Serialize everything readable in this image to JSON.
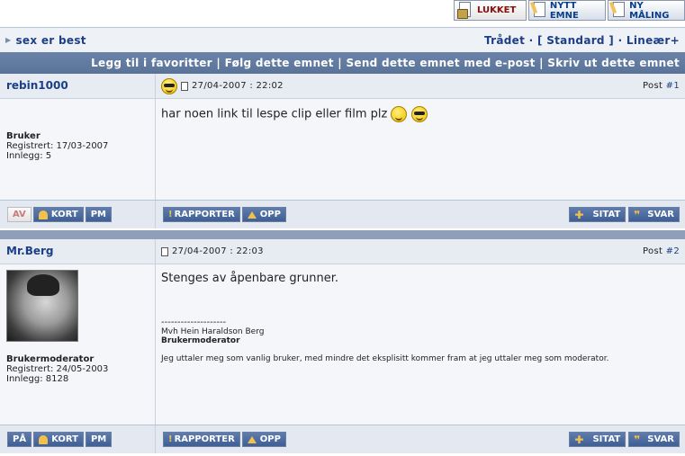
{
  "toolbar": {
    "locked_label": "LUKKET",
    "new_topic_label": "NYTT EMNE",
    "new_poll_label": "NY MÅLING"
  },
  "thread": {
    "title": "sex er best",
    "view_modes": "Trådet · [ Standard ] · Lineær+"
  },
  "actions": {
    "favorites": "Legg til i favoritter",
    "follow": "Følg dette emnet",
    "email": "Send dette emnet med e-post",
    "print": "Skriv ut dette emnet",
    "sep": "|"
  },
  "posts": [
    {
      "author": "rebin1000",
      "date": "27/04-2007 : 22:02",
      "post_label": "Post",
      "post_num": "#1",
      "role": "Bruker",
      "registered": "Registrert: 17/03-2007",
      "posts_count": "Innlegg: 5",
      "body": "har noen link til lespe clip eller film plz",
      "status_button": "AV",
      "profile_button": "KORT",
      "pm_button": "PM",
      "report_button": "RAPPORTER",
      "up_button": "OPP",
      "quote_button": "SITAT",
      "reply_button": "SVAR"
    },
    {
      "author": "Mr.Berg",
      "date": "27/04-2007 : 22:03",
      "post_label": "Post",
      "post_num": "#2",
      "role": "Brukermoderator",
      "registered": "Registrert: 24/05-2003",
      "posts_count": "Innlegg: 8128",
      "body": "Stenges av åpenbare grunner.",
      "sig_line": "--------------------",
      "sig_name": "Mvh Hein Haraldson Berg",
      "sig_role": "Brukermoderator",
      "sig_note": "Jeg uttaler meg som vanlig bruker, med mindre det eksplisitt kommer fram at jeg uttaler meg som moderator.",
      "status_button": "PÅ",
      "profile_button": "KORT",
      "pm_button": "PM",
      "report_button": "RAPPORTER",
      "up_button": "OPP",
      "quote_button": "SITAT",
      "reply_button": "SVAR"
    }
  ]
}
